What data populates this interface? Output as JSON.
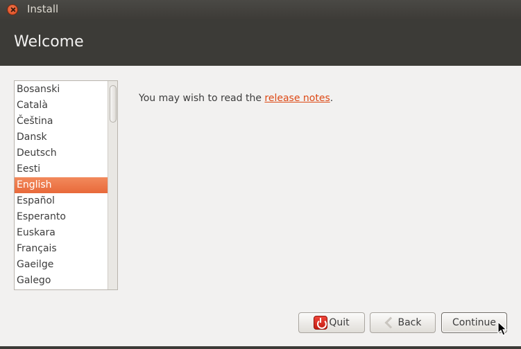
{
  "window": {
    "title": "Install"
  },
  "header": {
    "title": "Welcome"
  },
  "languages": {
    "items": [
      "Bosanski",
      "Català",
      "Čeština",
      "Dansk",
      "Deutsch",
      "Eesti",
      "English",
      "Español",
      "Esperanto",
      "Euskara",
      "Français",
      "Gaeilge",
      "Galego"
    ],
    "selected": "English"
  },
  "content": {
    "release_prefix": "You may wish to read the ",
    "release_link": "release notes",
    "release_suffix": "."
  },
  "buttons": {
    "quit": "Quit",
    "back": "Back",
    "continue": "Continue"
  },
  "icons": {
    "close": "close-icon",
    "quit": "power-icon",
    "back": "back-arrow-icon",
    "cursor": "mouse-cursor-icon"
  },
  "colors": {
    "accent": "#dd4814",
    "selection": "#e8693a",
    "header": "#3c3b37"
  }
}
